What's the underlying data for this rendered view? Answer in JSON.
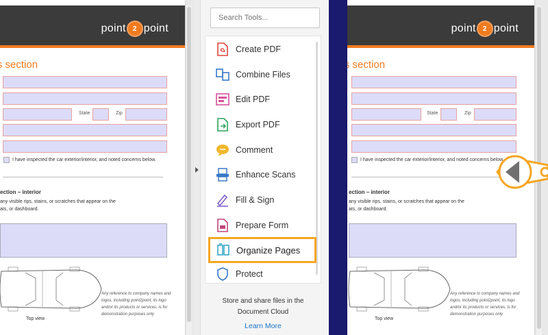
{
  "document": {
    "logo_text_left": "point",
    "logo_badge": "2",
    "logo_text_right": "point",
    "section_title": "r's section",
    "state_label": "State",
    "zip_label": "Zip",
    "inspected_text": "I have inspected the car exterior/interior, and noted concerns below.",
    "interior_title": "ection – interior",
    "interior_desc_1": "any visible rips, stains, or scratches that appear on the",
    "interior_desc_2": "ats, or dashboard.",
    "top_view_label": "Top view",
    "disclaimer": "Any reference to company names and logos, including point2point, its logo and/or its products or services, is for demonstration purposes only"
  },
  "tool_pane": {
    "search_placeholder": "Search Tools...",
    "tools": [
      {
        "label": "Create PDF",
        "icon": "create-pdf-icon",
        "color": "#e0463c"
      },
      {
        "label": "Combine Files",
        "icon": "combine-files-icon",
        "color": "#3a78c7"
      },
      {
        "label": "Edit PDF",
        "icon": "edit-pdf-icon",
        "color": "#d9529d"
      },
      {
        "label": "Export PDF",
        "icon": "export-pdf-icon",
        "color": "#2aa35a"
      },
      {
        "label": "Comment",
        "icon": "comment-icon",
        "color": "#f1b82d"
      },
      {
        "label": "Enhance Scans",
        "icon": "enhance-scans-icon",
        "color": "#3a78c7"
      },
      {
        "label": "Fill & Sign",
        "icon": "fill-sign-icon",
        "color": "#7b5cc7"
      },
      {
        "label": "Prepare Form",
        "icon": "prepare-form-icon",
        "color": "#c2447a"
      },
      {
        "label": "Organize Pages",
        "icon": "organize-pages-icon",
        "color": "#2aa3c7",
        "highlighted": true
      },
      {
        "label": "Protect",
        "icon": "protect-icon",
        "color": "#3a78c7"
      }
    ],
    "promo_line_1": "Store and share files in the",
    "promo_line_2": "Document Cloud",
    "learn_more": "Learn More"
  },
  "colors": {
    "accent_orange": "#f07b1f",
    "highlight_border": "#f5a623",
    "divider_navy": "#1a1a6e",
    "link_blue": "#1a73c8"
  }
}
